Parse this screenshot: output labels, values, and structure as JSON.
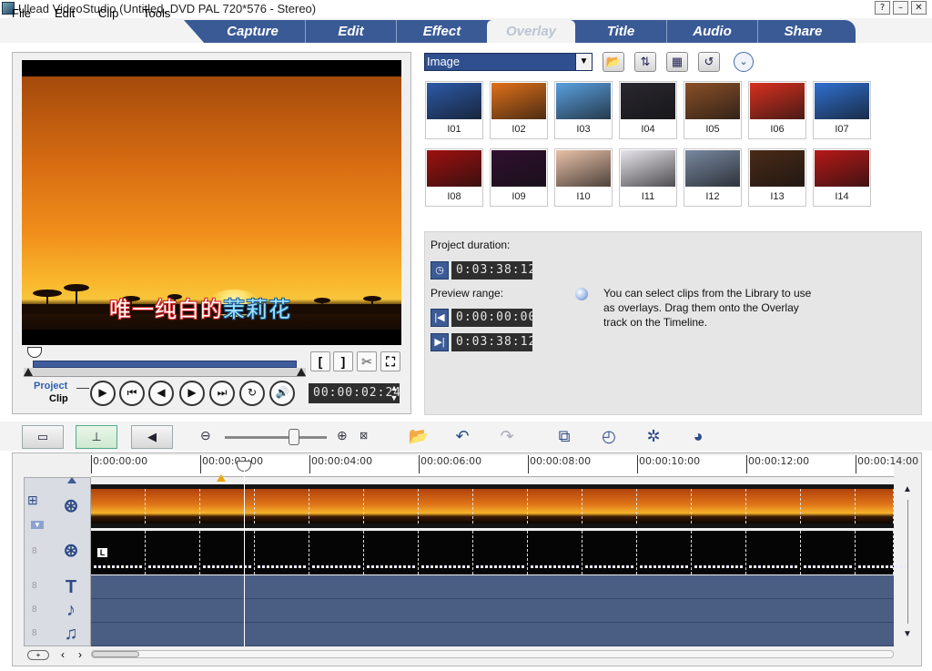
{
  "window": {
    "title": "Ulead VideoStudio (Untitled, DVD PAL 720*576 - Stereo)",
    "help_btn": "?",
    "min_btn": "–",
    "close_btn": "✕"
  },
  "menu": [
    "File",
    "Edit",
    "Clip",
    "Tools"
  ],
  "tabs": [
    "Capture",
    "Edit",
    "Effect",
    "Overlay",
    "Title",
    "Audio",
    "Share"
  ],
  "active_tab": "Overlay",
  "preview": {
    "subtitle_a": "唯一纯白的",
    "subtitle_b": "茉莉花",
    "mark_in": "[",
    "mark_out": "]",
    "mode_project": "Project",
    "mode_clip": "Clip",
    "timecode": "00:00:02:24",
    "colors": {
      "accent": "#3f5d9c",
      "sky_top": "#a44a0c",
      "sky_mid": "#f08e1b"
    }
  },
  "library": {
    "category": "Image",
    "thumbnails": [
      {
        "label": "I01",
        "color": "#2c5aa8"
      },
      {
        "label": "I02",
        "color": "#e0701a"
      },
      {
        "label": "I03",
        "color": "#5aa0e0"
      },
      {
        "label": "I04",
        "color": "#2a2830"
      },
      {
        "label": "I05",
        "color": "#8a5028"
      },
      {
        "label": "I06",
        "color": "#d83020"
      },
      {
        "label": "I07",
        "color": "#3070d0"
      },
      {
        "label": "I08",
        "color": "#a01010"
      },
      {
        "label": "I09",
        "color": "#301030"
      },
      {
        "label": "I10",
        "color": "#e8c0a8"
      },
      {
        "label": "I11",
        "color": "#e8e4ec"
      },
      {
        "label": "I12",
        "color": "#7888a0"
      },
      {
        "label": "I13",
        "color": "#4a2a18"
      },
      {
        "label": "I14",
        "color": "#b81818"
      }
    ]
  },
  "info": {
    "project_duration_label": "Project duration:",
    "project_duration": "0:03:38:12",
    "preview_range_label": "Preview range:",
    "range_start": "0:00:00:00",
    "range_end": "0:03:38:12",
    "hint": "You can select clips from the Library to use as overlays. Drag them onto the Overlay track on the Timeline."
  },
  "timeline": {
    "ruler": [
      "0:00:00:00",
      "00:00:02:00",
      "00:00:04:00",
      "00:00:06:00",
      "00:00:08:00",
      "00:00:10:00",
      "00:00:12:00",
      "00:00:14:00"
    ],
    "overlay_marker": "L",
    "track_numbers": [
      "8",
      "8",
      "8",
      "8"
    ]
  }
}
